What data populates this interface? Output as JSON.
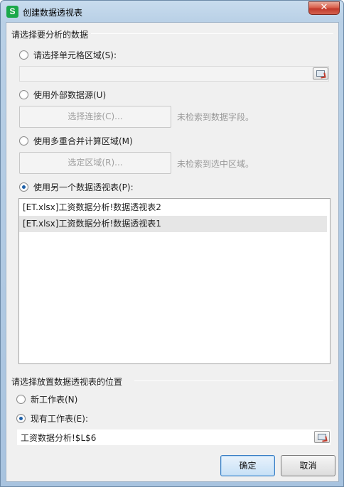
{
  "window": {
    "title": "创建数据透视表",
    "app_icon_letter": "S",
    "close_glyph": "✕"
  },
  "source_group": {
    "label": "请选择要分析的数据",
    "options": [
      {
        "label": "请选择单元格区域(S):",
        "checked": false
      },
      {
        "label": "使用外部数据源(U)",
        "checked": false
      },
      {
        "label": "使用多重合并计算区域(M)",
        "checked": false
      },
      {
        "label": "使用另一个数据透视表(P):",
        "checked": true
      }
    ],
    "range_value": "",
    "select_connection_button": "选择连接(C)...",
    "no_field_note": "未检索到数据字段。",
    "select_region_button": "选定区域(R)...",
    "no_region_note": "未检索到选中区域。",
    "pivot_list": [
      "[ET.xlsx]工资数据分析!数据透视表2",
      "[ET.xlsx]工资数据分析!数据透视表1"
    ],
    "selected_index": 1
  },
  "location_group": {
    "label": "请选择放置数据透视表的位置",
    "options": [
      {
        "label": "新工作表(N)",
        "checked": false
      },
      {
        "label": "现有工作表(E):",
        "checked": true
      }
    ],
    "location_value": "工资数据分析!$L$6"
  },
  "buttons": {
    "ok": "确定",
    "cancel": "取消"
  },
  "colors": {
    "accent": "#1c5fa8",
    "title_gradient_top": "#c8dcee",
    "close_red": "#c0392b",
    "app_icon_green": "#1aa84a"
  }
}
